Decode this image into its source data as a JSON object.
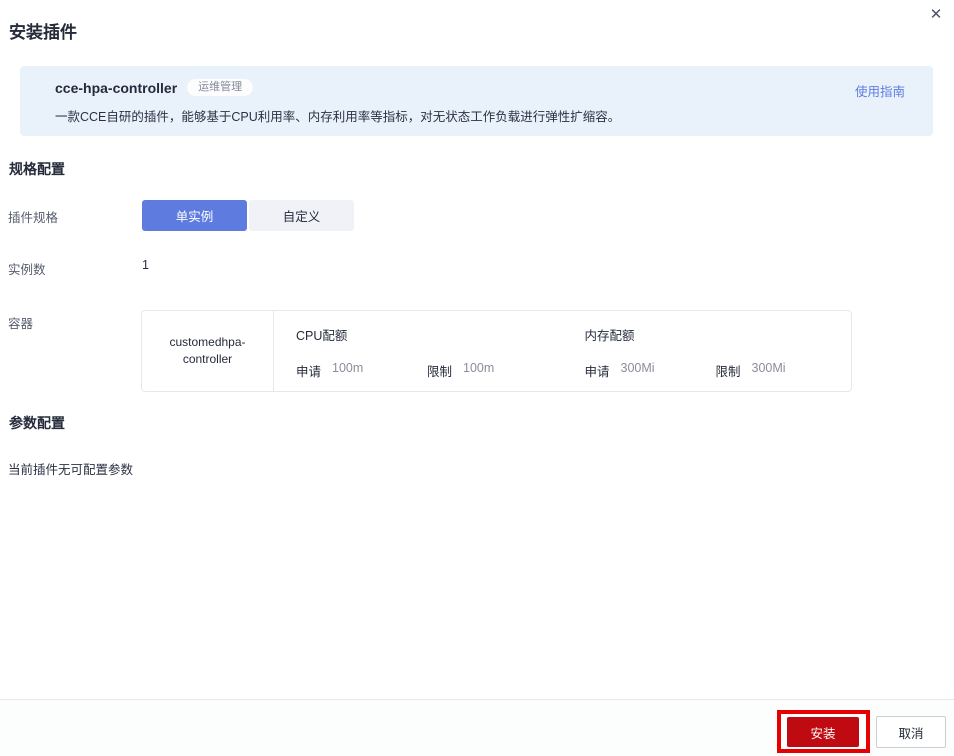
{
  "dialog": {
    "title": "安装插件"
  },
  "icons": {
    "close": "✕"
  },
  "plugin_card": {
    "name": "cce-hpa-controller",
    "badge": "运维管理",
    "guide_link": "使用指南",
    "description": "一款CCE自研的插件，能够基于CPU利用率、内存利用率等指标，对无状态工作负载进行弹性扩缩容。"
  },
  "spec_section": {
    "heading": "规格配置",
    "plugin_spec_label": "插件规格",
    "options": [
      {
        "label": "单实例",
        "selected": true
      },
      {
        "label": "自定义",
        "selected": false
      }
    ],
    "instances_label": "实例数",
    "instances_value": "1",
    "container_label": "容器",
    "container": {
      "name": "customedhpa-controller",
      "groups": [
        {
          "header": "CPU配额",
          "request_label": "申请",
          "request_value": "100m",
          "limit_label": "限制",
          "limit_value": "100m"
        },
        {
          "header": "内存配额",
          "request_label": "申请",
          "request_value": "300Mi",
          "limit_label": "限制",
          "limit_value": "300Mi"
        }
      ]
    }
  },
  "params_section": {
    "heading": "参数配置",
    "empty_text": "当前插件无可配置参数"
  },
  "footer": {
    "install_label": "安装",
    "cancel_label": "取消"
  },
  "colors": {
    "accent_blue": "#5e7ce0",
    "card_bg": "#e9f1fb",
    "danger_red": "#bf0a12",
    "annotation_red": "#e60000",
    "text_dark": "#252b3a",
    "text_gray": "#8a8e99"
  }
}
